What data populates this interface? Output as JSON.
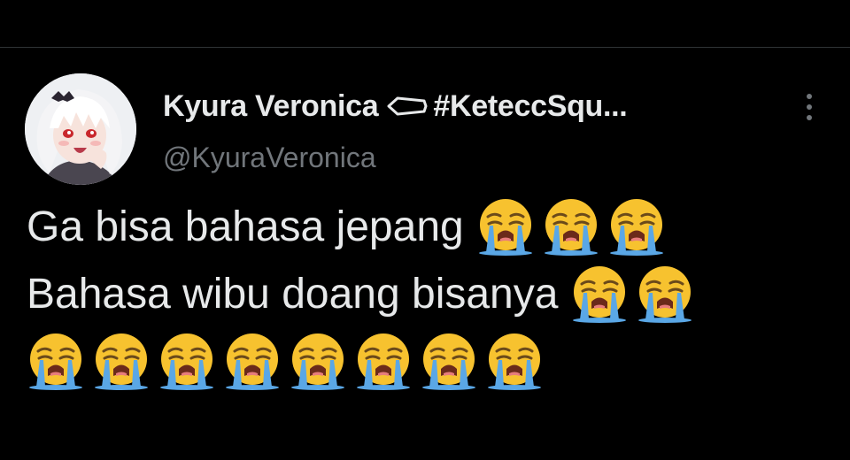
{
  "tweet": {
    "author": {
      "display_name": "Kyura Veronica",
      "name_icon": "coffin-icon",
      "hashtag": "#KeteccSqu...",
      "handle": "@KyuraVeronica",
      "avatar_icon": "anime-girl-avatar"
    },
    "menu_icon": "more-vertical-icon",
    "lines": [
      {
        "text": "Ga bisa bahasa jepang",
        "emoji_count": 3
      },
      {
        "text": "Bahasa wibu doang bisanya",
        "emoji_count": 2
      },
      {
        "text": "",
        "emoji_count": 8
      }
    ],
    "emoji": "loudly-crying-face-emoji"
  },
  "colors": {
    "background": "#000000",
    "primary_text": "#e7e9ea",
    "secondary_text": "#71767b",
    "divider": "#2f3336",
    "emoji_face": "#f7c22f",
    "emoji_tears": "#5aa7e6"
  }
}
